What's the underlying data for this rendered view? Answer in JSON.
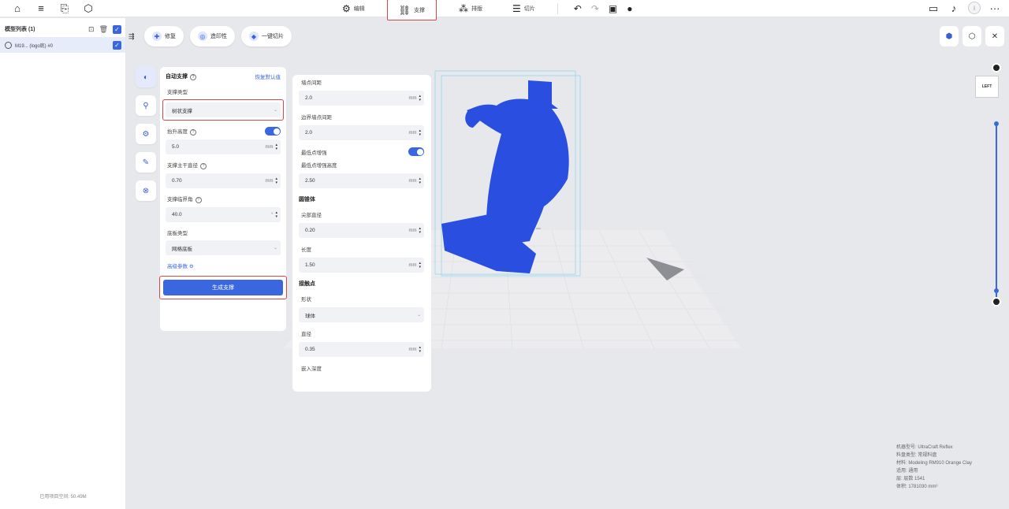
{
  "topbar": {
    "left_icons": [
      "home-icon",
      "menu-icon",
      "import-icon",
      "cube-icon"
    ],
    "tabs": [
      {
        "label": "编辑",
        "icon": "prepare-icon",
        "active": false
      },
      {
        "label": "支撑",
        "icon": "support-icon",
        "active": true
      },
      {
        "label": "排版",
        "icon": "layout-icon",
        "active": false
      },
      {
        "label": "切片",
        "icon": "slice-icon",
        "active": false
      }
    ],
    "tool_icons": [
      "undo-icon",
      "redo-icon",
      "save-icon",
      "github-icon"
    ],
    "right_icons": [
      "book-icon",
      "bell-icon",
      "avatar",
      "more-icon"
    ],
    "avatar_letter": "i",
    "more_label": "···"
  },
  "model_list": {
    "title": "模型列表 (1)",
    "row_name": "M19... (logo底) #0",
    "footer": "已用项目空间: 50.49M"
  },
  "viewport": {
    "buttons": [
      {
        "label": "修复"
      },
      {
        "label": "造印性"
      },
      {
        "label": "一键切片"
      }
    ],
    "view_cube_label": "LEFT",
    "info_lines": [
      "机器型号: UltraCraft Reflex",
      "料盘类型: 常规料盘",
      "材料: Modeling RM910 Orange Clay",
      "适用: 通用",
      "层: 层数 1541",
      "体积: 1781030 mm³"
    ]
  },
  "support_panel": {
    "title": "自动支撑",
    "restore_label": "恢复默认值",
    "support_type_label": "支撑类型",
    "support_type_value": "树状支撑",
    "lift_height_label": "抬升高度",
    "lift_height_value": "5.0",
    "main_diameter_label": "支撑主干直径",
    "main_diameter_value": "0.70",
    "angle_label": "支撑临界角",
    "angle_value": "40.0",
    "base_type_label": "底板类型",
    "base_type_value": "网格底板",
    "advanced_label": "高级参数",
    "generate_label": "生成支撑",
    "unit": "mm"
  },
  "advanced_panel": {
    "point_spacing_label": "墙点间距",
    "point_spacing_value": "2.0",
    "edge_spacing_label": "边界墙点间距",
    "edge_spacing_value": "2.0",
    "lowest_label": "最低点增强",
    "lowest_height_label": "最低点增强高度",
    "lowest_height_value": "2.50",
    "cone_section": "圆锥体",
    "tip_diameter_label": "尖部直径",
    "tip_diameter_value": "0.20",
    "length_label": "长度",
    "length_value": "1.50",
    "contact_section": "接触点",
    "shape_label": "形状",
    "shape_value": "球体",
    "diameter_label": "直径",
    "diameter_value": "0.35",
    "depth_label": "嵌入深度",
    "unit": "mm"
  },
  "colors": {
    "accent": "#3a66e0",
    "highlight_border": "#e24444",
    "model": "#2a4ee0",
    "bounding_box": "#8fd8f0"
  }
}
